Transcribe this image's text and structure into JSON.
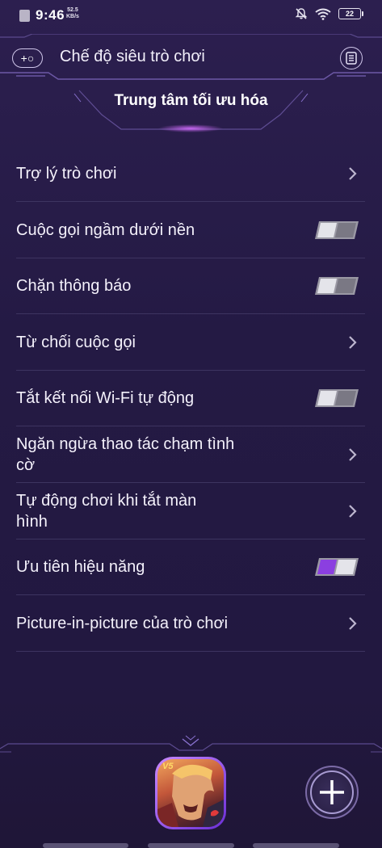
{
  "status_bar": {
    "time": "9:46",
    "speed_value": "52.5",
    "speed_unit": "KB/s",
    "battery": "22"
  },
  "header": {
    "title": "Chế độ siêu trò chơi",
    "gamepad_icon_text": "+○"
  },
  "section": {
    "title": "Trung tâm tối ưu hóa"
  },
  "list": {
    "items": [
      {
        "label": "Trợ lý trò chơi",
        "control": "chevron"
      },
      {
        "label": "Cuộc gọi ngầm dưới nền",
        "control": "toggle",
        "state": "off"
      },
      {
        "label": "Chặn thông báo",
        "control": "toggle",
        "state": "off"
      },
      {
        "label": "Từ chối cuộc gọi",
        "control": "chevron"
      },
      {
        "label": "Tắt kết nối Wi-Fi tự động",
        "control": "toggle",
        "state": "off"
      },
      {
        "label": "Ngăn ngừa thao tác chạm tình cờ",
        "control": "chevron"
      },
      {
        "label": "Tự động chơi khi tắt màn hình",
        "control": "chevron"
      },
      {
        "label": "Ưu tiên hiệu năng",
        "control": "toggle",
        "state": "on"
      },
      {
        "label": "Picture-in-picture của trò chơi",
        "control": "chevron"
      }
    ]
  },
  "bottom": {
    "game_badge": "V5"
  },
  "colors": {
    "background": "#2a1e4b",
    "toggle_on": "#8b3fe0",
    "toggle_off": "#c9c9cf",
    "divider": "#3d3460"
  }
}
